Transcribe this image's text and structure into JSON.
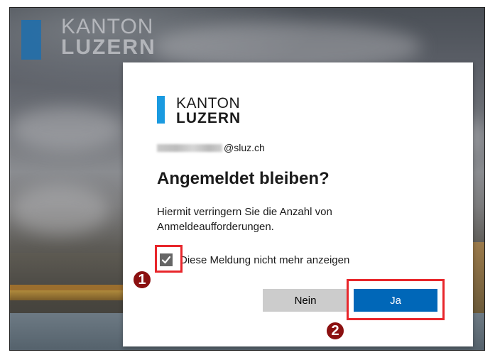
{
  "background_logo": {
    "line1": "KANTON",
    "line2": "LUZERN"
  },
  "dialog": {
    "logo": {
      "line1": "KANTON",
      "line2": "LUZERN"
    },
    "email_suffix": "@sluz.ch",
    "title": "Angemeldet bleiben?",
    "description": "Hiermit verringern Sie die Anzahl von Anmeldeaufforderungen.",
    "checkbox": {
      "label": "Diese Meldung nicht mehr anzeigen",
      "checked": true
    },
    "buttons": {
      "no": "Nein",
      "yes": "Ja"
    }
  },
  "annotations": {
    "step1": "1",
    "step2": "2",
    "highlight_color": "#e8262b",
    "marker_color": "#8b1010"
  },
  "colors": {
    "primary_button": "#0067b8",
    "secondary_button": "#cccccc",
    "logo_accent": "#1a9ae0"
  }
}
